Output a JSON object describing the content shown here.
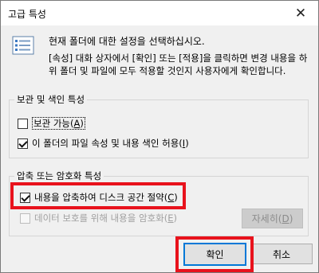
{
  "window": {
    "title": "고급 특성",
    "close_glyph": "✕"
  },
  "intro": {
    "icon": "properties-list-icon",
    "line1": "현재 폴더에 대한 설정을 선택하십시오.",
    "line2": "[속성] 대화 상자에서 [확인] 또는 [적용]을 클릭하면 변경 내용을 하위 폴더 및 파일에 모두 적용할 것인지 사용자에게 확인합니다."
  },
  "archive_group": {
    "label": "보관 및 색인 특성",
    "archive_label": "보관 가능(",
    "archive_key": "A",
    "archive_checked": false,
    "index_label": "이 폴더의 파일 속성 및 내용 색인 허용(",
    "index_key": "I",
    "index_checked": true
  },
  "compress_group": {
    "label": "압축 또는 암호화 특성",
    "compress_label": "내용을 압축하여 디스크 공간 절약(",
    "compress_key": "C",
    "compress_checked": true,
    "encrypt_label": "데이터 보호를 위해 내용을 암호화(",
    "encrypt_key": "E",
    "encrypt_checked": false,
    "details_label": "자세히(",
    "details_key": "D"
  },
  "buttons": {
    "ok": "확인",
    "cancel": "취소"
  },
  "colors": {
    "highlight": "#e8121c",
    "default_button_border": "#0078d7"
  }
}
